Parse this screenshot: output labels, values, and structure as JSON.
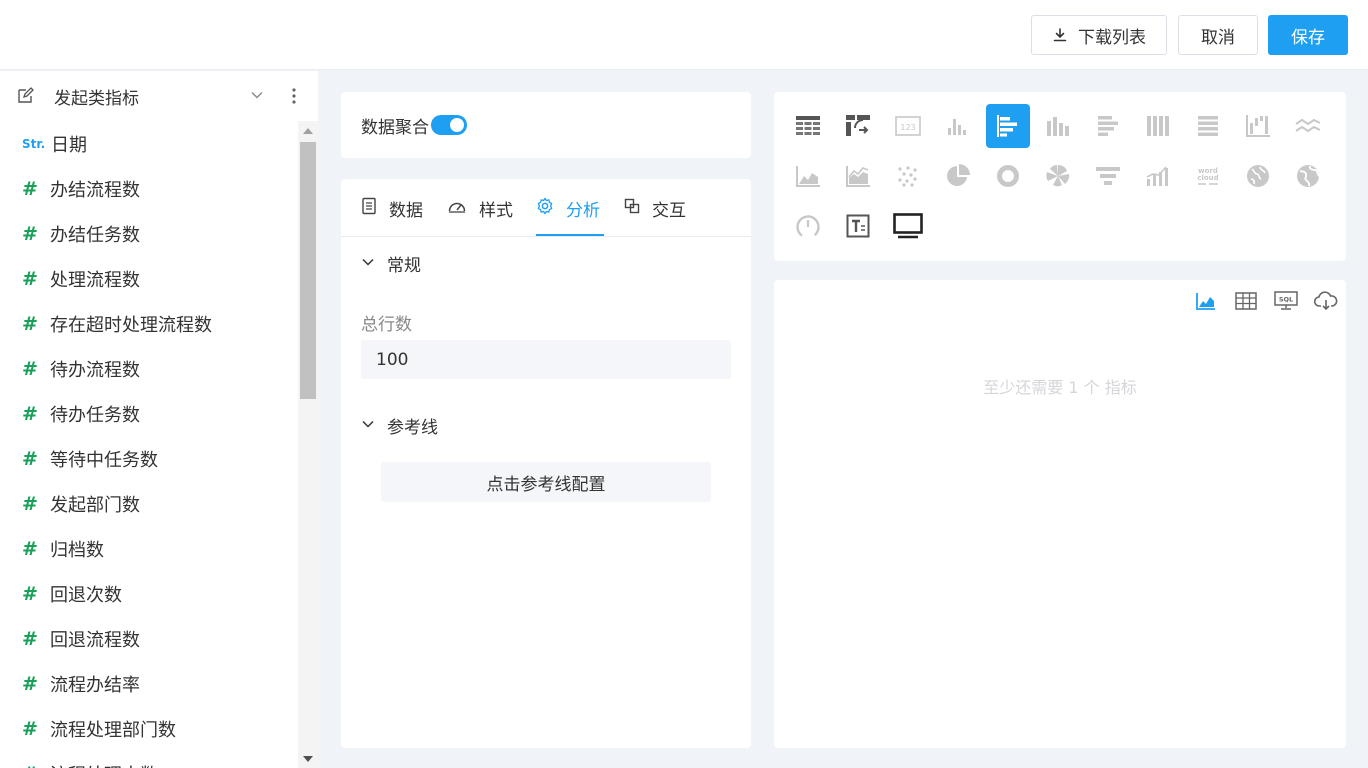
{
  "toolbar": {
    "download_label": "下载列表",
    "cancel_label": "取消",
    "save_label": "保存",
    "accent": "#1e9ff2"
  },
  "sidebar": {
    "title": "发起类指标",
    "items": [
      {
        "type": "Str.",
        "label": "日期"
      },
      {
        "type": "#",
        "label": "办结流程数"
      },
      {
        "type": "#",
        "label": "办结任务数"
      },
      {
        "type": "#",
        "label": "处理流程数"
      },
      {
        "type": "#",
        "label": "存在超时处理流程数"
      },
      {
        "type": "#",
        "label": "待办流程数"
      },
      {
        "type": "#",
        "label": "待办任务数"
      },
      {
        "type": "#",
        "label": "等待中任务数"
      },
      {
        "type": "#",
        "label": "发起部门数"
      },
      {
        "type": "#",
        "label": "归档数"
      },
      {
        "type": "#",
        "label": "回退次数"
      },
      {
        "type": "#",
        "label": "回退流程数"
      },
      {
        "type": "#",
        "label": "流程办结率"
      },
      {
        "type": "#",
        "label": "流程处理部门数"
      },
      {
        "type": "#",
        "label": "流程处理人数"
      }
    ]
  },
  "aggregation": {
    "label": "数据聚合",
    "enabled": true
  },
  "tabs": [
    {
      "label": "数据",
      "icon": "data-icon"
    },
    {
      "label": "样式",
      "icon": "gauge-icon"
    },
    {
      "label": "分析",
      "icon": "settings-icon",
      "active": true
    },
    {
      "label": "交互",
      "icon": "interaction-icon"
    }
  ],
  "analysis": {
    "general_title": "常规",
    "total_rows_label": "总行数",
    "total_rows_value": "100",
    "refline_title": "参考线",
    "refline_button": "点击参考线配置"
  },
  "chart_types": {
    "selected": "horizontal-bar-chart-icon",
    "icons": [
      "table-icon",
      "pivot-table-icon",
      "number-card-icon",
      "bar-chart-icon",
      "horizontal-bar-chart-icon",
      "grouped-bar-chart-icon",
      "stacked-horizontal-bar-icon",
      "percent-bar-icon",
      "percent-horizontal-bar-icon",
      "waterfall-chart-icon",
      "line-chart-icon",
      "area-chart-icon",
      "stacked-area-chart-icon",
      "scatter-chart-icon",
      "pie-chart-icon",
      "donut-chart-icon",
      "rose-chart-icon",
      "funnel-chart-icon",
      "bar-line-combo-icon",
      "word-cloud-icon",
      "map-icon",
      "globe-icon",
      "gauge-chart-icon",
      "text-card-icon",
      "screen-icon"
    ],
    "word_cloud_text": "word cloud"
  },
  "preview": {
    "hint": "至少还需要 1 个 指标",
    "sql_label": "SQL"
  }
}
